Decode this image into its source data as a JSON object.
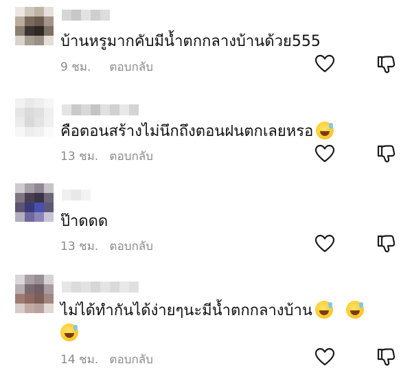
{
  "comments": [
    {
      "text": "บ้านหรูมากคับมีน้ำตกกลางบ้านด้วย555",
      "emoji_count": 0,
      "time": "9 ชม.",
      "reply_label": "ตอบกลับ"
    },
    {
      "text": "คือตอนสร้างไม่นึกถึงตอนฝนตกเลยหรอ",
      "emoji_count": 1,
      "time": "13 ชม.",
      "reply_label": "ตอบกลับ"
    },
    {
      "text": "ป๊าดดด",
      "emoji_count": 0,
      "time": "13 ชม.",
      "reply_label": "ตอบกลับ"
    },
    {
      "text": "ไม่ได้ทำกันได้ง่ายๆนะมีน้ำตกกลางบ้าน",
      "emoji_count": 3,
      "time": "14 ชม.",
      "reply_label": "ตอบกลับ"
    }
  ],
  "icons": {
    "like": "heart-outline-icon",
    "dislike": "thumbs-down-outline-icon",
    "emoji": "grinning-face-with-sweat-emoji"
  },
  "colors": {
    "text": "#111111",
    "meta": "#8a8a8a",
    "icon_stroke": "#1a1a1a"
  }
}
